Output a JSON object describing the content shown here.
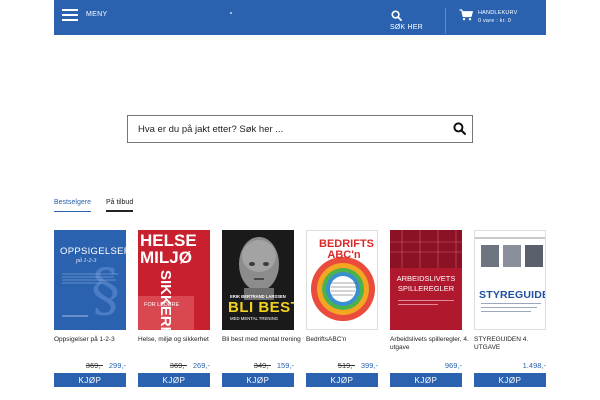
{
  "header": {
    "menu_label": "MENY",
    "search_label": "SØK HER",
    "cart_label": "HANDLEKURV",
    "cart_status": "0 vare : kr. 0"
  },
  "search": {
    "placeholder": "Hva er du på jakt etter? Søk her ..."
  },
  "tabs": [
    {
      "label": "Bestselgere"
    },
    {
      "label": "På tilbud"
    }
  ],
  "buy_label": "KJØP",
  "products": [
    {
      "title": "Oppsigelser på 1-2-3",
      "old_price": "369,-",
      "price": "299,-",
      "cover_title": "OPPSIGELSER",
      "cover_sub": "på 1-2-3"
    },
    {
      "title": "Helse, miljø og sikkerhet",
      "old_price": "369,-",
      "price": "269,-",
      "cover_title": "HELSE MILJØ",
      "cover_side": "SIKKERHET",
      "cover_sub": "FOR LEDERE"
    },
    {
      "title": "Bli best med mental trening",
      "old_price": "349,-",
      "price": "159,-",
      "cover_author": "ERIK BERTRAND LARSSEN",
      "cover_title": "BLI BEST",
      "cover_sub": "MED MENTAL TRENING"
    },
    {
      "title": "BedriftsABC'n",
      "old_price": "519,-",
      "price": "399,-",
      "cover_title": "BEDRIFTS ABC'n"
    },
    {
      "title": "Arbeidslivets spilleregler, 4. utgave",
      "old_price": "",
      "price": "969,-",
      "cover_title": "ARBEIDSLIVETS SPILLEREGLER"
    },
    {
      "title": "STYREGUIDEN 4. UTGAVE",
      "old_price": "",
      "price": "1.498,-",
      "cover_title": "STYREGUIDEN"
    }
  ],
  "colors": {
    "brand": "#2a62b0",
    "helse_red": "#c8202e",
    "abc_blue": "#3a8fd0",
    "arbeid_red": "#b0182e"
  }
}
